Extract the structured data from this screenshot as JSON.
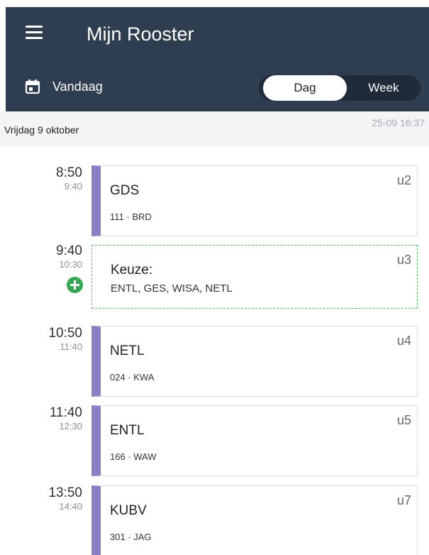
{
  "header": {
    "title": "Mijn Rooster",
    "menu_icon": "menu-icon",
    "today_label": "Vandaag",
    "today_icon": "calendar-icon",
    "view_toggle": {
      "day": "Dag",
      "week": "Week",
      "selected": "Dag"
    },
    "background_color": "#2e3d4f"
  },
  "datebar": {
    "date": "Vrijdag 9 oktober",
    "updated": "25-09 16:37"
  },
  "schedule": [
    {
      "kind": "lesson",
      "start": "8:50",
      "end": "9:40",
      "subject": "GDS",
      "details": "111 · BRD",
      "period": "u2"
    },
    {
      "kind": "choice",
      "start": "9:40",
      "end": "10:30",
      "subject": "Keuze:",
      "details": "ENTL, GES, WISA, NETL",
      "period": "u3",
      "action_icon": "add-circle-icon"
    },
    {
      "kind": "lesson",
      "start": "10:50",
      "end": "11:40",
      "subject": "NETL",
      "details": "024 · KWA",
      "period": "u4"
    },
    {
      "kind": "lesson",
      "start": "11:40",
      "end": "12:30",
      "subject": "ENTL",
      "details": "166 · WAW",
      "period": "u5"
    },
    {
      "kind": "lesson",
      "start": "13:50",
      "end": "14:40",
      "subject": "KUBV",
      "details": "301 · JAG",
      "period": "u7"
    }
  ],
  "colors": {
    "lesson_accent": "#8a7fc6",
    "choice_border": "#55b85d",
    "add_button": "#36a854"
  }
}
